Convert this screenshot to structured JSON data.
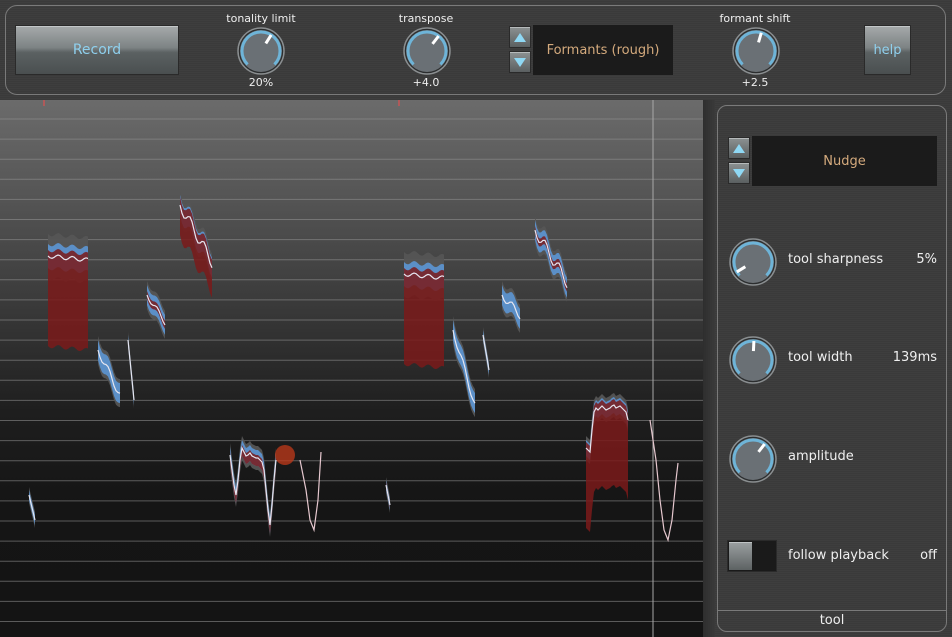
{
  "top_bar": {
    "record_label": "Record",
    "help_label": "help",
    "tonality_limit": {
      "label": "tonality limit",
      "value": "20%",
      "fraction": 0.62
    },
    "transpose": {
      "label": "transpose",
      "value": "+4.0",
      "fraction": 0.64
    },
    "formant_shift": {
      "label": "formant shift",
      "value": "+2.5",
      "fraction": 0.56
    },
    "mode_selector": {
      "value": "Formants (rough)",
      "up_icon": "triangle-up-icon",
      "down_icon": "triangle-down-icon"
    }
  },
  "tool_panel": {
    "title": "tool",
    "tool_selector": {
      "value": "Nudge"
    },
    "params": [
      {
        "label": "tool sharpness",
        "value": "5%",
        "fraction": 0.05
      },
      {
        "label": "tool width",
        "value": "139ms",
        "fraction": 0.51
      },
      {
        "label": "amplitude",
        "value": "",
        "fraction": 0.64
      }
    ],
    "follow_playback": {
      "label": "follow playback",
      "value": "off"
    }
  },
  "colors": {
    "accent_blue": "#8fd0ee",
    "selector_text": "#d4aa7d",
    "knob_ring": "#6eb4d8",
    "pitch_blue": "#5b8fc7",
    "pitch_red": "#7a1a1a"
  }
}
